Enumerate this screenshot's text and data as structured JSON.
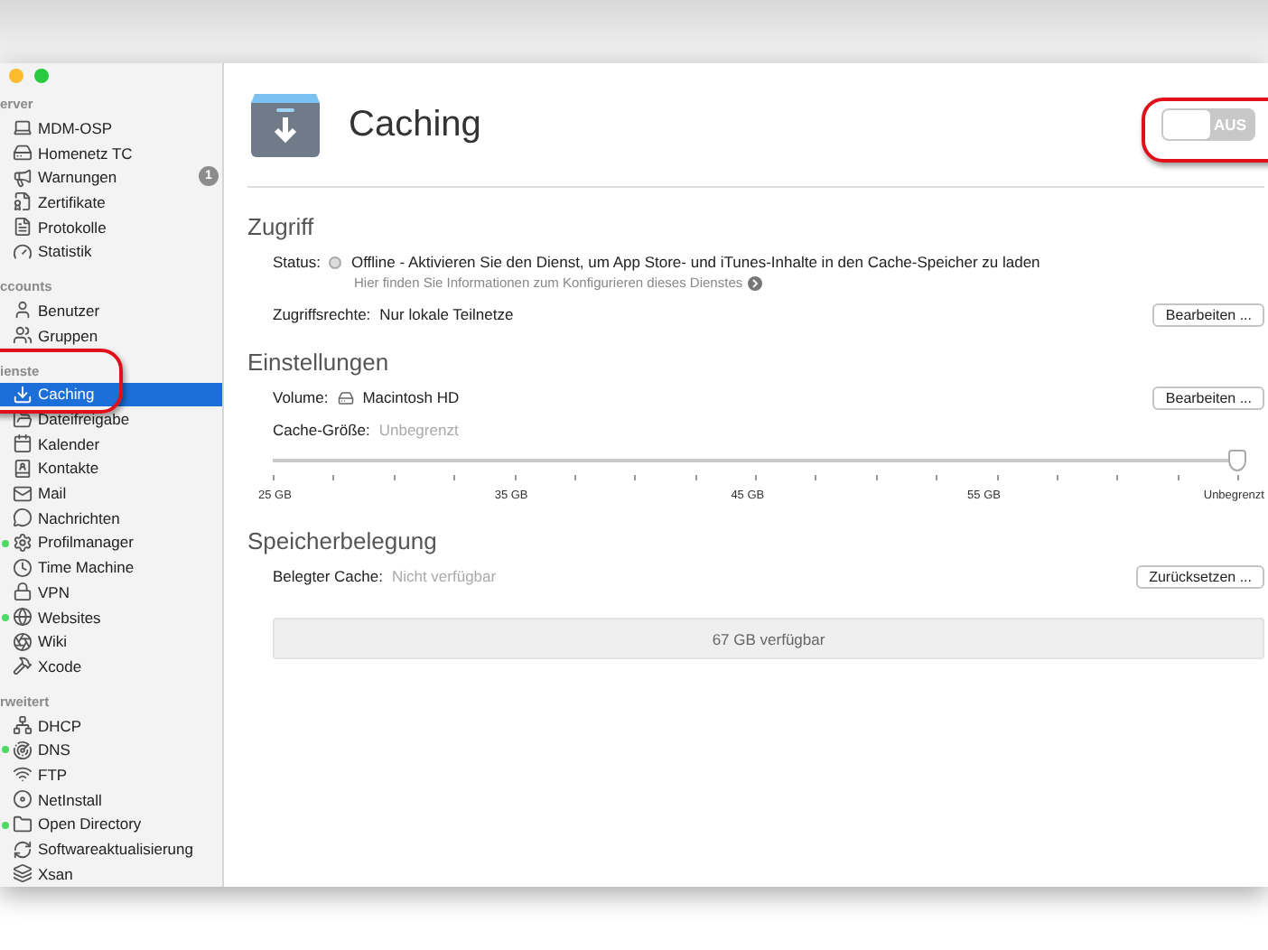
{
  "sidebar": {
    "sections": [
      {
        "header": "erver",
        "items": [
          {
            "label": "MDM-OSP",
            "selected": false,
            "running": false
          },
          {
            "label": "Homenetz TC",
            "selected": false,
            "running": false
          },
          {
            "label": "Warnungen",
            "selected": false,
            "running": false,
            "badge": "1"
          },
          {
            "label": "Zertifikate",
            "selected": false,
            "running": false
          },
          {
            "label": "Protokolle",
            "selected": false,
            "running": false
          },
          {
            "label": "Statistik",
            "selected": false,
            "running": false
          }
        ]
      },
      {
        "header": "ccounts",
        "items": [
          {
            "label": "Benutzer",
            "selected": false,
            "running": false
          },
          {
            "label": "Gruppen",
            "selected": false,
            "running": false
          }
        ]
      },
      {
        "header": "ienste",
        "items": [
          {
            "label": "Caching",
            "selected": true,
            "running": false
          },
          {
            "label": "Dateifreigabe",
            "selected": false,
            "running": false
          },
          {
            "label": "Kalender",
            "selected": false,
            "running": false
          },
          {
            "label": "Kontakte",
            "selected": false,
            "running": false
          },
          {
            "label": "Mail",
            "selected": false,
            "running": false
          },
          {
            "label": "Nachrichten",
            "selected": false,
            "running": false
          },
          {
            "label": "Profilmanager",
            "selected": false,
            "running": true
          },
          {
            "label": "Time Machine",
            "selected": false,
            "running": false
          },
          {
            "label": "VPN",
            "selected": false,
            "running": false
          },
          {
            "label": "Websites",
            "selected": false,
            "running": true
          },
          {
            "label": "Wiki",
            "selected": false,
            "running": false
          },
          {
            "label": "Xcode",
            "selected": false,
            "running": false
          }
        ]
      },
      {
        "header": "rweitert",
        "items": [
          {
            "label": "DHCP",
            "selected": false,
            "running": false
          },
          {
            "label": "DNS",
            "selected": false,
            "running": true
          },
          {
            "label": "FTP",
            "selected": false,
            "running": false
          },
          {
            "label": "NetInstall",
            "selected": false,
            "running": false
          },
          {
            "label": "Open Directory",
            "selected": false,
            "running": true
          },
          {
            "label": "Softwareaktualisierung",
            "selected": false,
            "running": false
          },
          {
            "label": "Xsan",
            "selected": false,
            "running": false
          }
        ]
      }
    ]
  },
  "header": {
    "title": "Caching",
    "toggle": {
      "label": "AUS",
      "on": false
    }
  },
  "access": {
    "heading": "Zugriff",
    "status_label": "Status:",
    "status": "Offline - Aktivieren Sie den Dienst, um App Store- und iTunes-Inhalte in den Cache-Speicher zu laden",
    "help_link": "Hier finden Sie Informationen zum Konfigurieren dieses Dienstes",
    "rights_label": "Zugriffsrechte:",
    "rights": "Nur lokale Teilnetze",
    "button": "Bearbeiten ..."
  },
  "settings": {
    "heading": "Einstellungen",
    "volume_label": "Volume:",
    "volume": "Macintosh HD",
    "button": "Bearbeiten ...",
    "size_label": "Cache-Größe:",
    "size": "Unbegrenzt",
    "slider": {
      "level": 1,
      "labels": [
        "25 GB",
        "35 GB",
        "45 GB",
        "55 GB",
        "Unbegrenzt"
      ]
    }
  },
  "usage": {
    "heading": "Speicherbelegung",
    "cache_label": "Belegter Cache:",
    "cache": "Nicht verfügbar",
    "button": "Zurücksetzen ...",
    "available": "67 GB verfügbar"
  }
}
